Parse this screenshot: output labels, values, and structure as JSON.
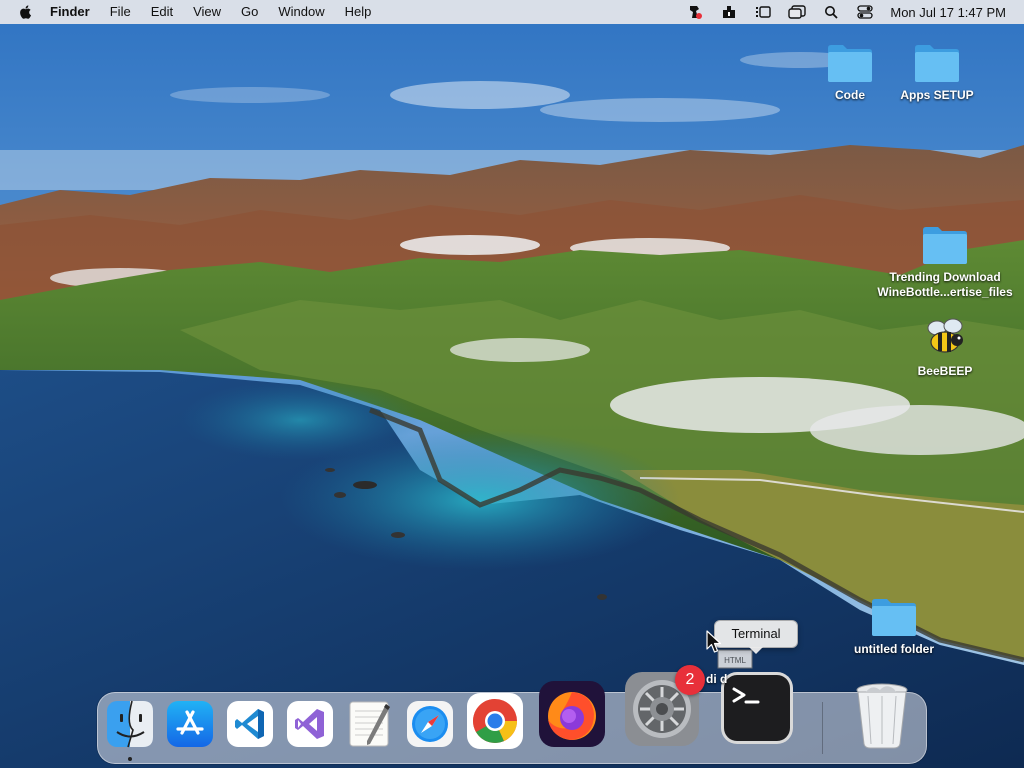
{
  "menubar": {
    "app_name": "Finder",
    "menus": [
      "File",
      "Edit",
      "View",
      "Go",
      "Window",
      "Help"
    ],
    "status_icons": [
      "status-app-icon",
      "bluetooth-app-icon",
      "stage-manager-icon",
      "mission-control-icon",
      "spotlight-search-icon",
      "control-center-icon"
    ],
    "clock": "Mon Jul 17  1:47 PM"
  },
  "desktop": {
    "icons": [
      {
        "label": "Code",
        "type": "folder"
      },
      {
        "label": "Apps SETUP",
        "type": "folder"
      },
      {
        "label_line1": "Trending Download",
        "label_line2": "WineBottle...ertise_files",
        "type": "folder"
      },
      {
        "label": "BeeBEEP",
        "type": "app"
      },
      {
        "label": "untitled folder",
        "type": "folder"
      }
    ],
    "drag_label": "di           d",
    "drag_badge": "HTML"
  },
  "tooltip": {
    "text": "Terminal"
  },
  "dock": {
    "apps": [
      {
        "name": "Finder",
        "icon": "finder-icon",
        "running": true
      },
      {
        "name": "App Store",
        "icon": "app-store-icon",
        "running": false
      },
      {
        "name": "Visual Studio Code",
        "icon": "vscode-icon",
        "running": false
      },
      {
        "name": "Visual Studio",
        "icon": "visual-studio-icon",
        "running": false
      },
      {
        "name": "TextEdit",
        "icon": "textedit-icon",
        "running": false
      },
      {
        "name": "Safari",
        "icon": "safari-icon",
        "running": false
      },
      {
        "name": "Google Chrome",
        "icon": "chrome-icon",
        "running": false
      },
      {
        "name": "Firefox",
        "icon": "firefox-icon",
        "running": false
      },
      {
        "name": "System Settings",
        "icon": "system-settings-icon",
        "running": false,
        "badge": "2"
      },
      {
        "name": "Terminal",
        "icon": "terminal-icon",
        "running": false
      },
      {
        "name": "Trash",
        "icon": "trash-icon",
        "running": false
      }
    ]
  },
  "colors": {
    "folder": "#5ab7f0",
    "badge": "#e8303a",
    "menubar": "#e8e8ec"
  }
}
